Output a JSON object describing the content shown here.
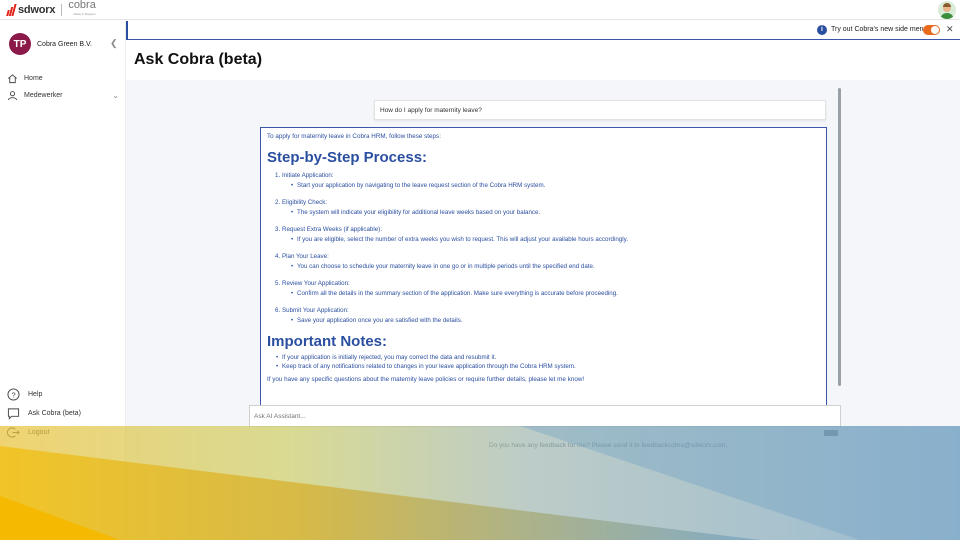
{
  "brand": {
    "name": "sdworx",
    "product": "cobra",
    "product_tag": "Made in Belgium"
  },
  "company": {
    "initials": "TP",
    "name": "Cobra Green B.V."
  },
  "sidebar": {
    "items": [
      {
        "label": "Home",
        "icon": "home-icon"
      },
      {
        "label": "Medewerker",
        "icon": "person-icon"
      }
    ],
    "bottom": [
      {
        "label": "Help",
        "icon": "help-icon"
      },
      {
        "label": "Ask Cobra (beta)",
        "icon": "chat-icon"
      },
      {
        "label": "Logout",
        "icon": "logout-icon"
      }
    ]
  },
  "notice": {
    "text": "Try out Cobra's new side menu",
    "toggle_on": true
  },
  "page": {
    "title": "Ask Cobra (beta)"
  },
  "chat": {
    "question": "How do I apply for maternity leave?",
    "answer": {
      "intro": "To apply for maternity leave in Cobra HRM, follow these steps:",
      "heading": "Step-by-Step Process:",
      "steps": [
        {
          "num": "1.",
          "title": "Initiate Application",
          "detail": "Start your application by navigating to the leave request section of the Cobra HRM system."
        },
        {
          "num": "2.",
          "title": "Eligibility Check",
          "detail": "The system will indicate your eligibility for additional leave weeks based on your balance."
        },
        {
          "num": "3.",
          "title": "Request Extra Weeks (if applicable)",
          "detail": "If you are eligible, select the number of extra weeks you wish to request. This will adjust your available hours accordingly."
        },
        {
          "num": "4.",
          "title": "Plan Your Leave",
          "detail": "You can choose to schedule your maternity leave in one go or in multiple periods until the specified end date."
        },
        {
          "num": "5.",
          "title": "Review Your Application",
          "detail": "Confirm all the details in the summary section of the application. Make sure everything is accurate before proceeding."
        },
        {
          "num": "6.",
          "title": "Submit Your Application",
          "detail": "Save your application once you are satisfied with the details."
        }
      ],
      "notes_heading": "Important Notes:",
      "notes": [
        "If your application is initially rejected, you may correct the data and resubmit it.",
        "Keep track of any notifications related to changes in your leave application through the Cobra HRM system."
      ],
      "closing": "If you have any specific questions about the maternity leave policies or require further details, please let me know!"
    },
    "input_placeholder": "Ask AI Assistant...",
    "feedback": "Do you have any feedback for me? Please send it to feedbackcobra@sdworx.com."
  },
  "colors": {
    "accent": "#2b4fa0",
    "toggle": "#e86a1c",
    "company_logo": "#8b1a4a",
    "brand_red": "#e2231a"
  }
}
